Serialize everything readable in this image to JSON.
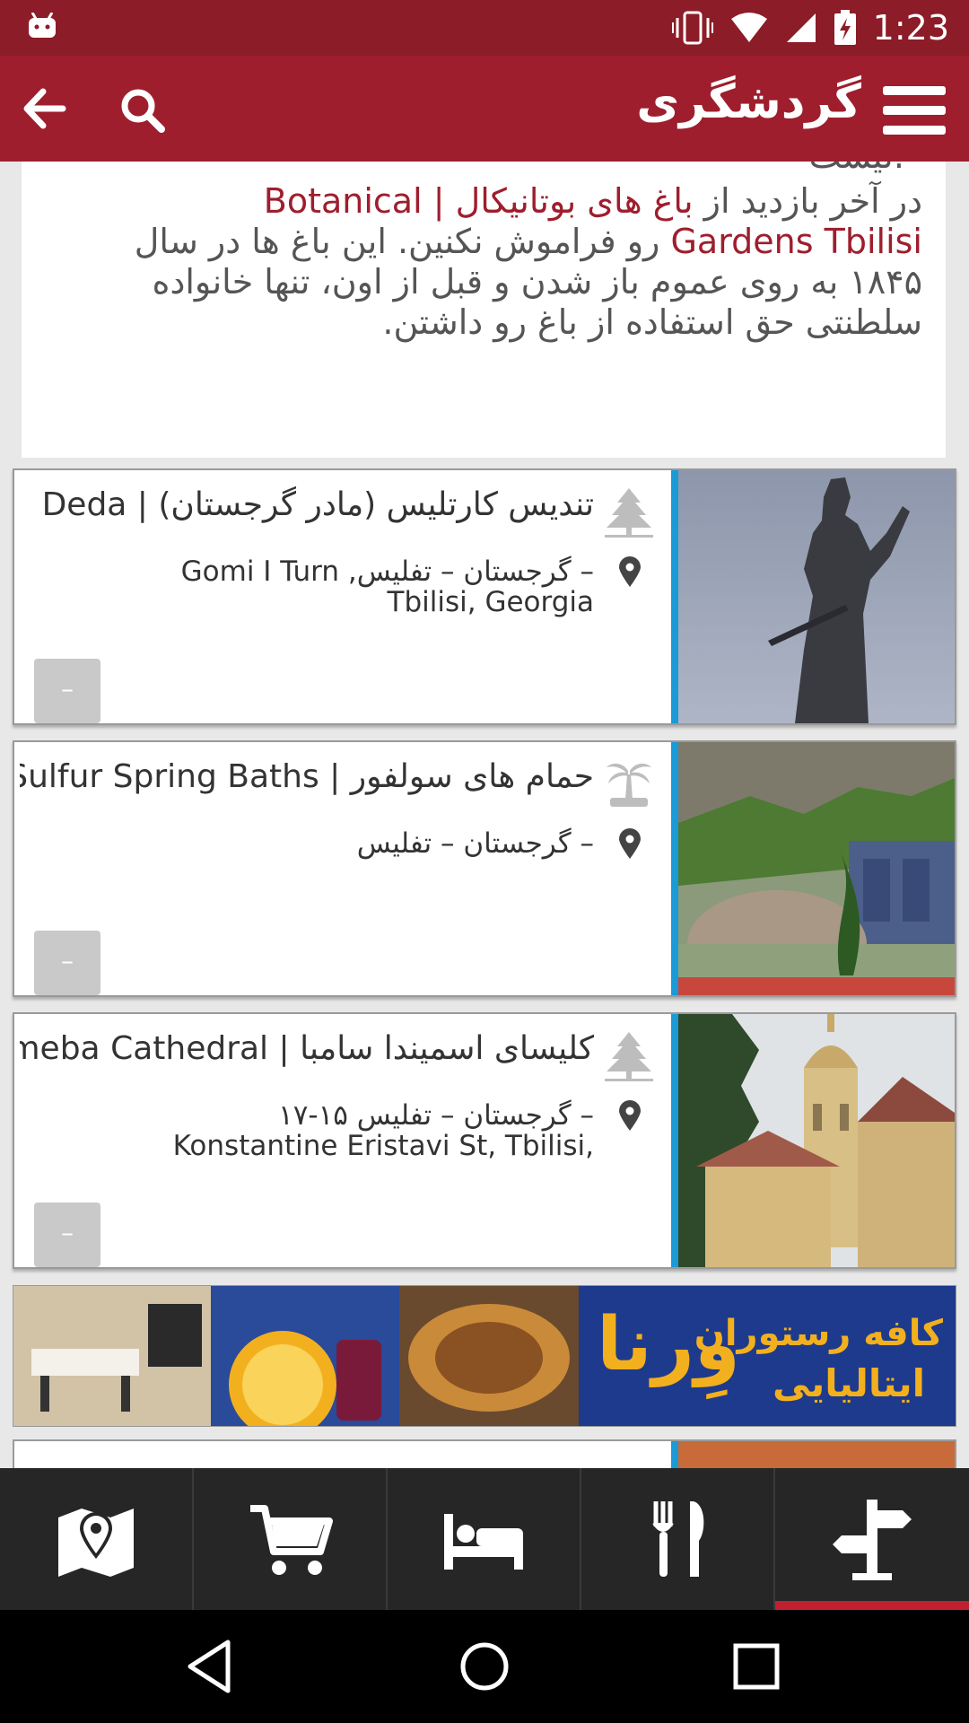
{
  "status_bar": {
    "time": "1:23"
  },
  "app_bar": {
    "title": "گردشگری"
  },
  "article": {
    "cut_line": "لیست.",
    "line1_prefix": "در آخر بازدید از ",
    "line1_link": "باغ های بوتانیکال | Botanical",
    "line2_link": "Gardens Tbilisi",
    "line2_suffix": " رو فراموش نکنین. این باغ ها در سال",
    "line3": "۱۸۴۵ به روی عموم باز شدن و قبل از اون، تنها خانواده",
    "line4": "سلطنتی حق استفاده از باغ رو داشتن."
  },
  "places": [
    {
      "title": "تندیس کارتلیس (مادر گرجستان) | Deda",
      "address_line1": "– گرجستان – تفلیس, Gomi I Turn",
      "address_line2": "Tbilisi, Georgia",
      "category_icon": "tree-icon",
      "button_label": "–"
    },
    {
      "title": "حمام های سولفور | Sulfur Spring Baths",
      "address_line1": "– گرجستان – تفلیس",
      "address_line2": "",
      "category_icon": "palm-tree-icon",
      "button_label": "–"
    },
    {
      "title": "کلیسای اسمیندا سامبا | Sameba Cathedral",
      "address_line1": "– گرجستان – تفلیس ۱۵-۱۷",
      "address_line2": "Konstantine Eristavi St, Tbilisi,",
      "category_icon": "tree-icon",
      "button_label": "–"
    }
  ],
  "banner": {
    "line1": "کافه رستوران",
    "line2": "ایتالیایی",
    "brand": "وِرنا"
  },
  "tabs": [
    {
      "icon": "map-pin-icon"
    },
    {
      "icon": "cart-icon"
    },
    {
      "icon": "bed-icon"
    },
    {
      "icon": "restaurant-icon"
    },
    {
      "icon": "signpost-icon",
      "active": true
    }
  ],
  "colors": {
    "primary": "#9e1e2d",
    "accent_strip": "#1a9ad6",
    "tab_bar": "#262626"
  }
}
